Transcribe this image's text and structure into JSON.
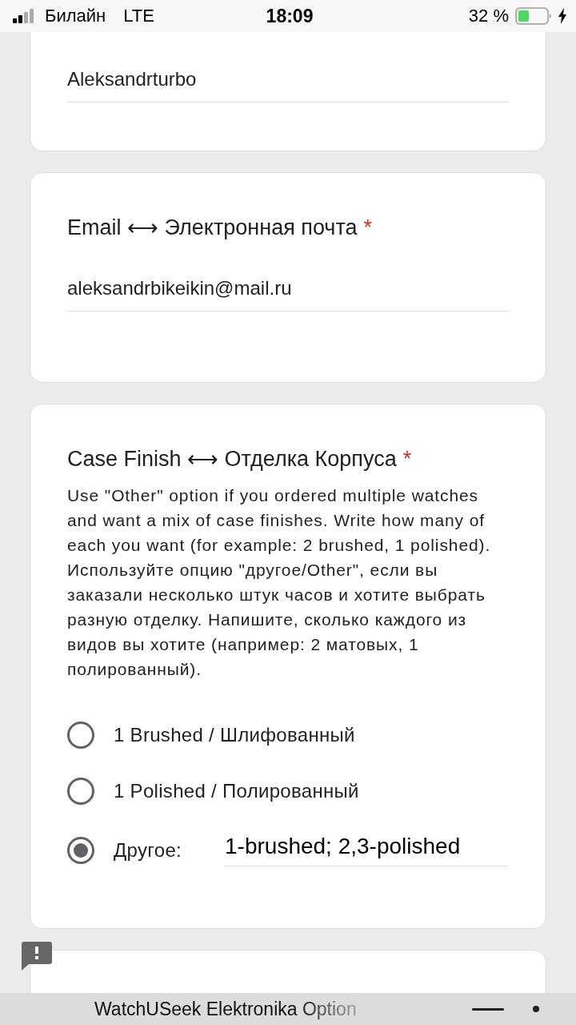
{
  "status_bar": {
    "carrier": "Билайн",
    "network": "LTE",
    "time": "18:09",
    "battery": "32 %"
  },
  "questions": [
    {
      "value": "Aleksandrturbo"
    },
    {
      "title": "Email ⟷ Электронная почта",
      "value": "aleksandrbikeikin@mail.ru",
      "required_mark": "*"
    },
    {
      "title": "Case Finish ⟷ Отделка Корпуса",
      "required_mark": "*",
      "description": "Use \"Other\" option if you ordered multiple watches and want a mix of case finishes. Write how many of each you want (for example: 2 brushed, 1 polished). Используйте опцию \"другое/Other\", если вы заказали несколько штук часов и хотите выбрать разную отделку. Напишите, сколько каждого из видов вы хотите (например: 2 матовых, 1 полированный).",
      "options": [
        {
          "kind": "radio",
          "label": "1 Brushed / Шлифованный",
          "selected": false
        },
        {
          "kind": "radio",
          "label": "1 Polished / Полированный",
          "selected": false
        },
        {
          "kind": "other",
          "label": "Другое:",
          "value": "1-brushed; 2,3-polished",
          "selected": true
        }
      ]
    },
    {
      "kind": "blank"
    }
  ],
  "bottom_bar": {
    "title": "WatchUSeek Elektronika Option"
  }
}
